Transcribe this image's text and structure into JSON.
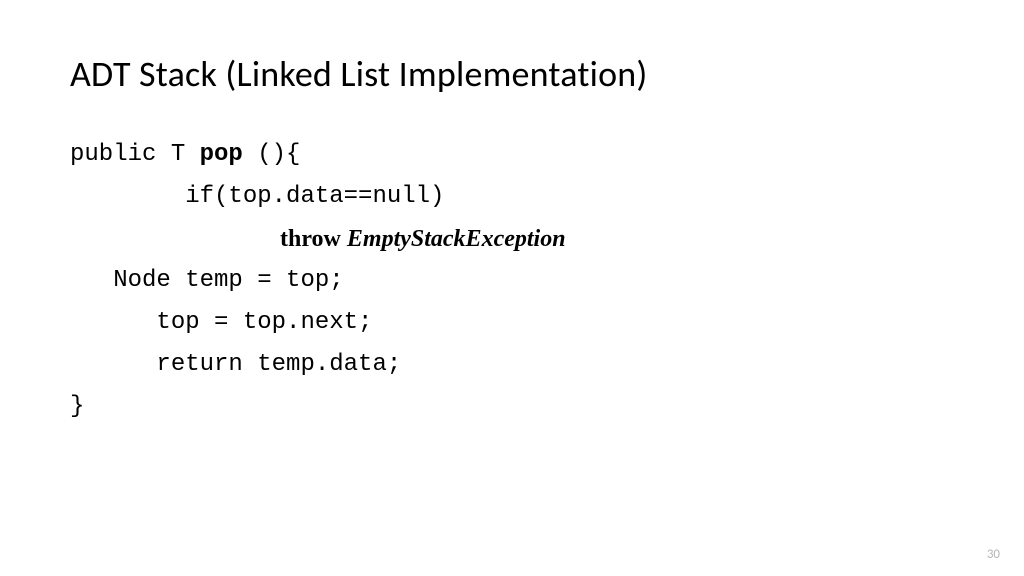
{
  "title": "ADT Stack (Linked List Implementation)",
  "code": {
    "line1_prefix": "public T ",
    "line1_method": "pop",
    "line1_suffix": " (){",
    "line2": "        if(top.data==null)",
    "line3_throw": "throw ",
    "line3_exception": "EmptyStackException",
    "line4": "   Node temp = top;",
    "line5": "      top = top.next;",
    "line6": "      return temp.data;",
    "line7": "}"
  },
  "page_number": "30"
}
